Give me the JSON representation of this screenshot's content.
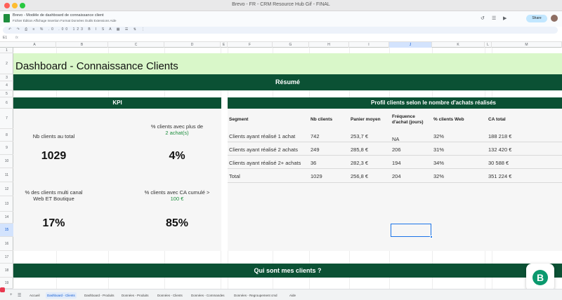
{
  "window": {
    "title": "Brevo - FR - CRM Resource Hub Gif - FINAL"
  },
  "doc": {
    "title": "Brevo - Modèle de dashboard de connaissance client",
    "menu": "Fichier  Édition  Affichage  Insertion  Format  Données  Outils  Extensions  Aide",
    "share_label": "Share",
    "namebox": "E1",
    "fx": "fx"
  },
  "grid": {
    "columns": [
      "A",
      "B",
      "C",
      "D",
      "E",
      "F",
      "G",
      "H",
      "I",
      "J",
      "K",
      "L",
      "M"
    ],
    "rows": [
      "1",
      "2",
      "3",
      "4",
      "5",
      "6",
      "7",
      "8",
      "9",
      "10",
      "11",
      "12",
      "13",
      "14",
      "15",
      "16",
      "17",
      "18",
      "19"
    ]
  },
  "dashboard": {
    "title": "Dashboard - Connaissance Clients",
    "resume": "Résumé",
    "kpi_header": "KPI",
    "profil_header": "Profil clients selon le nombre d'achats réalisés",
    "qui_sont": "Qui sont mes clients ?"
  },
  "kpis": [
    {
      "label": "Nb clients au total",
      "value": "1029"
    },
    {
      "label": "% clients avec plus de",
      "label2": "2 achat(s)",
      "value": "4%"
    },
    {
      "label": "% des clients multi canal",
      "label2": "Web ET Boutique",
      "value": "17%"
    },
    {
      "label": "% clients avec CA cumulé >",
      "label2": "100 €",
      "value": "85%"
    }
  ],
  "table": {
    "headers": [
      "Segment",
      "Nb clients",
      "Panier moyen",
      "Fréquence d'achat (jours)",
      "% clients Web",
      "CA total"
    ],
    "rows": [
      [
        "Clients ayant réalisé 1 achat",
        "742",
        "253,7 €",
        "NA",
        "32%",
        "188 218 €"
      ],
      [
        "Clients ayant réalisé 2 achats",
        "249",
        "285,8 €",
        "206",
        "31%",
        "132 420 €"
      ],
      [
        "Clients ayant réalisé 2+ achats",
        "36",
        "282,3 €",
        "194",
        "34%",
        "30 588 €"
      ]
    ],
    "total": [
      "Total",
      "1029",
      "256,8 €",
      "204",
      "32%",
      "351 224 €"
    ]
  },
  "tabs": {
    "items": [
      "Accueil",
      "Dashboard - Clients",
      "Dashboard - Produits",
      "Données - Produits",
      "Données - Clients",
      "Données - Commandes",
      "Données - Regroupement cmd",
      "Aide"
    ],
    "active_index": 1
  },
  "colors": {
    "dark_green": "#0b5134",
    "light_green": "#d9f7c9",
    "brevo": "#0b996e"
  }
}
